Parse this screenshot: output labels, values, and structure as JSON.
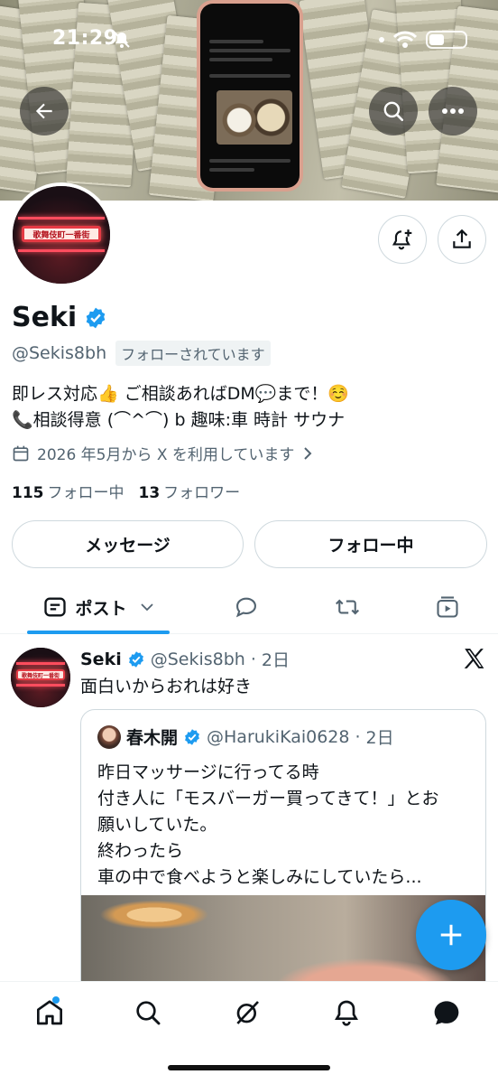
{
  "status_bar": {
    "time": "21:29"
  },
  "profile": {
    "name": "Seki",
    "handle": "@Sekis8bh",
    "follows_you": "フォローされています",
    "bio_line1": "即レス対応👍 ご相談あればDM💬まで！☺️",
    "bio_line2": "📞相談得意 (⌒^⌒) b 趣味:車 時計 サウナ",
    "joined": "2026 年5月から X を利用しています",
    "following_count": "115",
    "following_label": "フォロー中",
    "followers_count": "13",
    "followers_label": "フォロワー",
    "avatar_sign": "歌舞伎町一番街"
  },
  "actions": {
    "message": "メッセージ",
    "following": "フォロー中"
  },
  "tabs": {
    "posts": "ポスト"
  },
  "post": {
    "author": "Seki",
    "handle": "@Sekis8bh",
    "time": "2日",
    "text": "面白いからおれは好き",
    "quote": {
      "author": "春木開",
      "handle": "@HarukiKai0628",
      "time": "2日",
      "lines": [
        "昨日マッサージに行ってる時",
        "付き人に「モスバーガー買ってきて！」とお",
        "願いしていた。",
        "終わったら",
        "車の中で食べようと楽しみにしていたら..."
      ]
    }
  },
  "colors": {
    "accent": "#1d9bf0",
    "text": "#0f1419",
    "muted": "#536471",
    "border": "#cfd9de"
  },
  "icons": {
    "back": "arrow-left-icon",
    "search": "search-icon",
    "more": "more-icon",
    "notify": "bell-plus-icon",
    "share": "share-icon",
    "verified": "verified-badge-icon",
    "calendar": "calendar-icon",
    "chevron": "chevron-right-icon",
    "compose": "plus-icon",
    "nav": [
      "home-icon",
      "search-icon",
      "grok-icon",
      "bell-icon",
      "messages-icon"
    ]
  }
}
